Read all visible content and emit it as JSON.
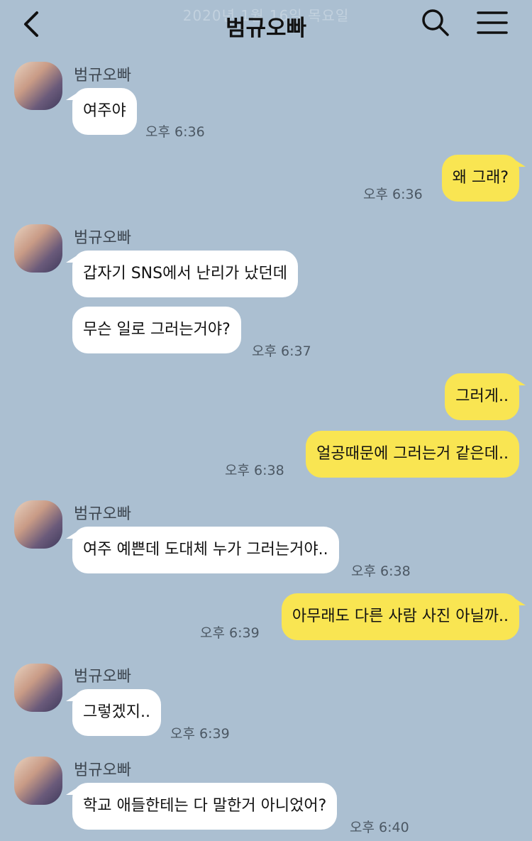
{
  "header": {
    "title": "범규오빠",
    "date_ghost": "2020년 1월 16일 목요일"
  },
  "colors": {
    "background": "#abbfd1",
    "incoming_bubble": "#ffffff",
    "outgoing_bubble": "#f9e552"
  },
  "icons": {
    "back": "chevron-left-icon",
    "search": "search-icon",
    "menu": "hamburger-menu-icon"
  },
  "messages": [
    {
      "sender": "범규오빠",
      "text": "여주야",
      "time": "오후 6:36"
    },
    {
      "text": "왜 그래?",
      "time": "오후 6:36"
    },
    {
      "sender": "범규오빠",
      "text": "갑자기 SNS에서 난리가 났던데"
    },
    {
      "text": "무슨 일로 그러는거야?",
      "time": "오후 6:37"
    },
    {
      "text": "그러게.."
    },
    {
      "text": "얼공때문에 그러는거 같은데..",
      "time": "오후 6:38"
    },
    {
      "sender": "범규오빠",
      "text": "여주 예쁜데 도대체 누가 그러는거야..",
      "time": "오후 6:38"
    },
    {
      "text": "아무래도 다른 사람 사진 아닐까..",
      "time": "오후 6:39"
    },
    {
      "sender": "범규오빠",
      "text": "그렇겠지..",
      "time": "오후 6:39"
    },
    {
      "sender": "범규오빠",
      "text": "학교 애들한테는 다 말한거 아니었어?",
      "time": "오후 6:40"
    }
  ]
}
